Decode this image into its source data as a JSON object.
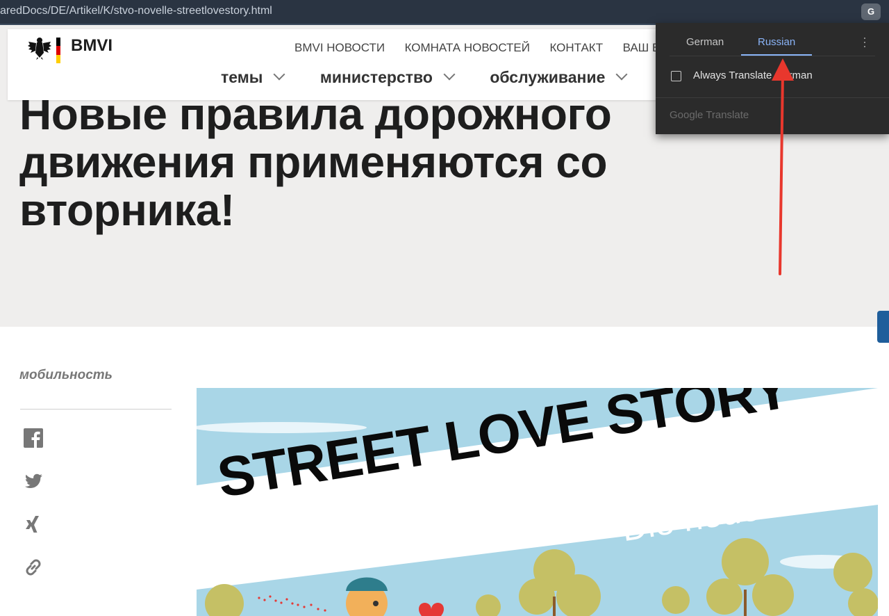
{
  "browser": {
    "url": "aredDocs/DE/Artikel/K/stvo-novelle-streetlovestory.html"
  },
  "site": {
    "logo_text": "BMVI",
    "top_nav": [
      "BMVI НОВОСТИ",
      "КОМНАТА НОВОСТЕЙ",
      "КОНТАКТ",
      "ВАШ В"
    ],
    "main_nav": [
      "темы",
      "министерство",
      "обслуживание"
    ],
    "flag_colors": [
      "#000000",
      "#dd0000",
      "#ffce00"
    ]
  },
  "hero": {
    "title": "Новые правила дорожного движения применяются со вторника!"
  },
  "sidebar": {
    "section_label": "мобильность",
    "share_icons": [
      "facebook-icon",
      "twitter-icon",
      "xing-icon",
      "link-icon"
    ]
  },
  "article_image": {
    "title": "STREET LOVE STORY",
    "subtitle": "Die neue StVO"
  },
  "translate_popup": {
    "tabs": [
      "German",
      "Russian"
    ],
    "active_tab": "Russian",
    "always_translate": "Always Translate German",
    "always_checked": false,
    "brand": "Google Translate",
    "accent_color": "#8ab4f8"
  },
  "annotation": {
    "arrow_color": "#e8372d"
  }
}
